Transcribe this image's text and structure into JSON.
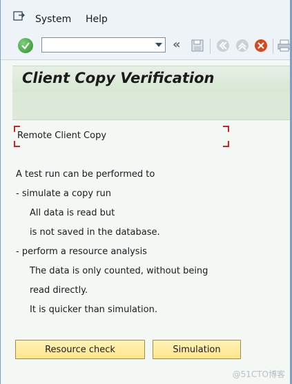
{
  "menubar": {
    "items": [
      {
        "label": "System",
        "mnemonic": "S"
      },
      {
        "label": "Help",
        "mnemonic": "H"
      }
    ]
  },
  "toolbar": {
    "command_field_value": "",
    "icons": [
      "enter-icon",
      "back-icon",
      "save-icon",
      "back-nav-icon",
      "exit-icon",
      "cancel-icon",
      "print-icon"
    ]
  },
  "page": {
    "title": "Client Copy Verification"
  },
  "content": {
    "heading": "Remote Client Copy",
    "lines": [
      "A test run can be performed to",
      "- simulate a copy run",
      "All data is read but",
      "is not saved in the database.",
      "- perform a resource analysis",
      "The data is only counted, without being",
      "read directly.",
      "It is quicker than simulation."
    ]
  },
  "buttons": {
    "resource_check": "Resource check",
    "simulation": "Simulation"
  },
  "watermark": "@51CTO博客",
  "colors": {
    "button_bg": "#ffe58a",
    "title_bar_bg": "#d7e6d3",
    "cancel_red": "#d9481a",
    "enter_green": "#2f8f2c"
  }
}
